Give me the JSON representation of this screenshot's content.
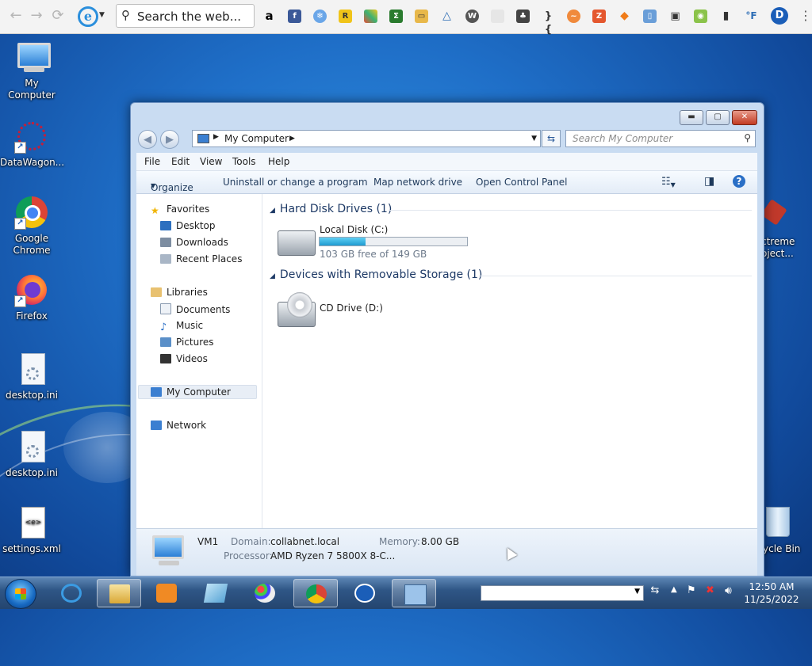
{
  "browser_toolbar": {
    "search_text": "Search the web...",
    "ie_letter": "e",
    "extension_d_letter": "D",
    "extensions": [
      "amazon-icon",
      "facebook-icon",
      "snowflake-icon",
      "r-icon",
      "colorful-icon",
      "sigma-icon",
      "folder-icon",
      "delta-icon",
      "w-icon",
      "light-icon",
      "tree-icon",
      "brackets-icon",
      "orange-circle-icon",
      "z-icon",
      "fish-icon",
      "phone-icon",
      "car-icon",
      "android-icon",
      "bookmark-icon",
      "temperature-icon"
    ],
    "temp_label": "°F"
  },
  "desktop_icons": [
    {
      "label": "My Computer"
    },
    {
      "label": "DataWagon..."
    },
    {
      "label": "Google Chrome"
    },
    {
      "label": "Firefox"
    },
    {
      "label": "desktop.ini"
    },
    {
      "label": "desktop.ini"
    },
    {
      "label": "settings.xml"
    },
    {
      "label": "ctreme oject..."
    },
    {
      "label": "ycle Bin"
    }
  ],
  "explorer": {
    "address_crumb": "My Computer",
    "search_placeholder": "Search My Computer",
    "menu": [
      "File",
      "Edit",
      "View",
      "Tools",
      "Help"
    ],
    "commands": {
      "organize": "Organize",
      "uninstall": "Uninstall or change a program",
      "map_drive": "Map network drive",
      "control_panel": "Open Control Panel"
    },
    "nav": {
      "favorites": "Favorites",
      "desktop": "Desktop",
      "downloads": "Downloads",
      "recent": "Recent Places",
      "libraries": "Libraries",
      "documents": "Documents",
      "music": "Music",
      "pictures": "Pictures",
      "videos": "Videos",
      "my_computer": "My Computer",
      "network": "Network"
    },
    "groups": {
      "hdd": "Hard Disk Drives (1)",
      "removable": "Devices with Removable Storage (1)"
    },
    "drives": {
      "local_name": "Local Disk (C:)",
      "local_free": "103 GB free of 149 GB",
      "local_used_fraction": 0.31,
      "cd_name": "CD Drive (D:)"
    },
    "details": {
      "computer_name": "VM1",
      "domain_label": "Domain:",
      "domain_value": "collabnet.local",
      "memory_label": "Memory:",
      "memory_value": "8.00 GB",
      "processor_label": "Processor:",
      "processor_value": "AMD Ryzen 7 5800X 8-C..."
    }
  },
  "taskbar": {
    "time": "12:50 AM",
    "date": "11/25/2022"
  },
  "colors": {
    "accent": "#1f6fc8",
    "taskbar": "#2f5686",
    "progress": "#1f9bd0"
  }
}
